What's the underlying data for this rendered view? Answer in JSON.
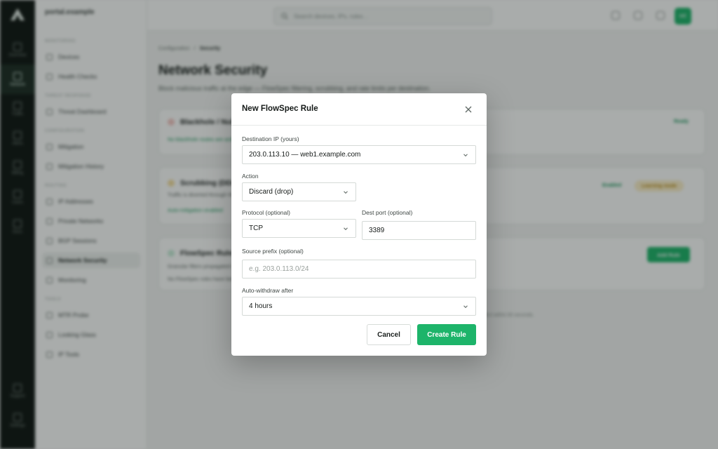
{
  "rail": {
    "items": [
      {
        "label": "Overview",
        "icon": "grid-icon"
      },
      {
        "label": "Network",
        "icon": "network-icon"
      },
      {
        "label": "Traffic",
        "icon": "chart-icon"
      },
      {
        "label": "Alerts",
        "icon": "bell-icon"
      },
      {
        "label": "Billing",
        "icon": "card-icon"
      },
      {
        "label": "Users",
        "icon": "user-icon"
      },
      {
        "label": "Docs",
        "icon": "book-icon"
      },
      {
        "label": "Support",
        "icon": "help-icon"
      },
      {
        "label": "Settings",
        "icon": "gear-icon"
      }
    ]
  },
  "sidebar": {
    "brand": "portal.example",
    "sections": [
      "Monitoring",
      "Threat Response",
      "Configuration",
      "Routing",
      "Tools"
    ],
    "items": [
      {
        "label": "Devices"
      },
      {
        "label": "Health Checks"
      },
      {
        "label": "Threat Dashboard"
      },
      {
        "label": "Mitigation"
      },
      {
        "label": "Mitigation History"
      },
      {
        "label": "IP Addresses"
      },
      {
        "label": "Private Networks"
      },
      {
        "label": "BGP Sessions"
      },
      {
        "label": "Network Security"
      },
      {
        "label": "Monitoring"
      },
      {
        "label": "MTR Probe"
      },
      {
        "label": "Looking Glass"
      },
      {
        "label": "IP Tools"
      }
    ]
  },
  "topbar": {
    "search_placeholder": "Search devices, IPs, rules…",
    "avatar_text": "ME"
  },
  "page": {
    "breadcrumb": [
      "Configuration",
      "Security"
    ],
    "title": "Network Security",
    "subtitle": "Block malicious traffic at the edge — FlowSpec filtering, scrubbing, and rate limits per destination.",
    "cards": [
      {
        "title": "Blackhole / Null-route",
        "line": "No blackhole routes are active",
        "status": "Ready"
      },
      {
        "title": "Scrubbing (DDoS protection)",
        "line": "Traffic is diverted through the scrubbing centre when an attack is detected.",
        "good": "Auto-mitigation enabled",
        "status": "Enabled",
        "badge": "Learning mode"
      },
      {
        "title": "FlowSpec Rules",
        "line": "Granular filters propagated via BGP FlowSpec.",
        "empty": "No FlowSpec rules have been created yet.",
        "button": "Add Rule"
      }
    ],
    "footer": "Changes take effect within 60 seconds."
  },
  "modal": {
    "title": "New FlowSpec Rule",
    "close_icon": "close-icon",
    "fields": {
      "destination": {
        "label": "Destination IP (yours)",
        "value": "203.0.113.10 — web1.example.com"
      },
      "action": {
        "label": "Action",
        "value": "Discard (drop)"
      },
      "protocol": {
        "label": "Protocol (optional)",
        "value": "TCP"
      },
      "dest_port": {
        "label": "Dest port (optional)",
        "value": "3389"
      },
      "source_prefix": {
        "label": "Source prefix (optional)",
        "placeholder": "e.g. 203.0.113.0/24"
      },
      "auto_withdraw": {
        "label": "Auto-withdraw after",
        "value": "4 hours"
      }
    },
    "buttons": {
      "cancel": "Cancel",
      "create": "Create Rule"
    }
  },
  "colors": {
    "accent": "#1db46a",
    "rail_bg": "#0e1411",
    "amber_badge": "#fcefc9"
  }
}
